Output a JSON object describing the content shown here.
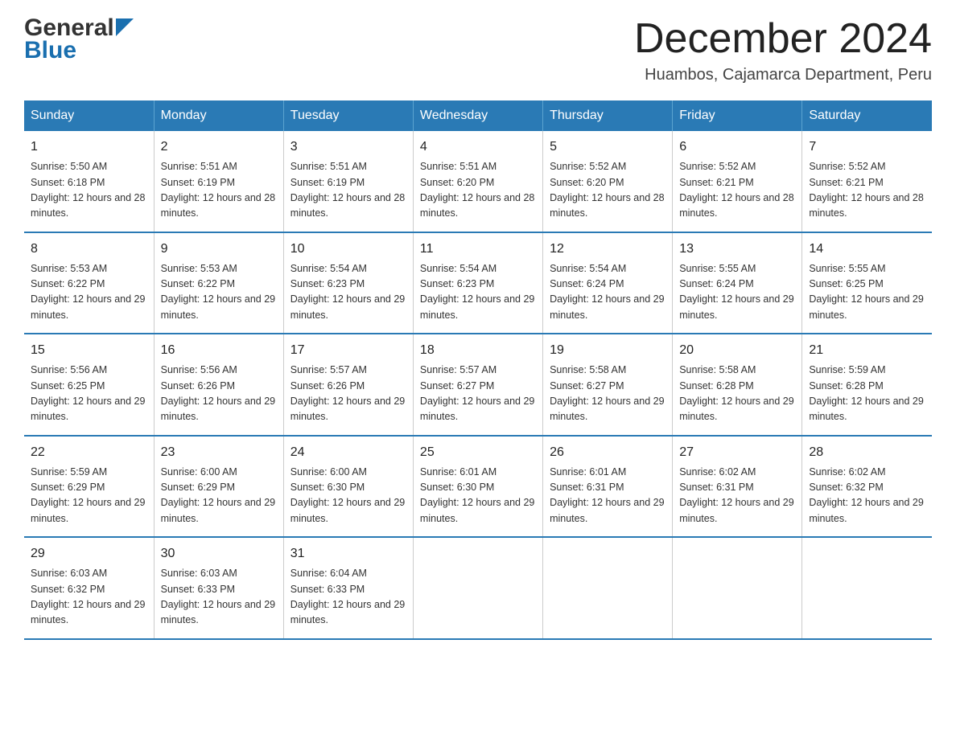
{
  "logo": {
    "general": "General",
    "blue": "Blue",
    "triangle_color": "#1a6faf"
  },
  "title": "December 2024",
  "subtitle": "Huambos, Cajamarca Department, Peru",
  "weekdays": [
    "Sunday",
    "Monday",
    "Tuesday",
    "Wednesday",
    "Thursday",
    "Friday",
    "Saturday"
  ],
  "weeks": [
    [
      {
        "day": "1",
        "sunrise": "Sunrise: 5:50 AM",
        "sunset": "Sunset: 6:18 PM",
        "daylight": "Daylight: 12 hours and 28 minutes."
      },
      {
        "day": "2",
        "sunrise": "Sunrise: 5:51 AM",
        "sunset": "Sunset: 6:19 PM",
        "daylight": "Daylight: 12 hours and 28 minutes."
      },
      {
        "day": "3",
        "sunrise": "Sunrise: 5:51 AM",
        "sunset": "Sunset: 6:19 PM",
        "daylight": "Daylight: 12 hours and 28 minutes."
      },
      {
        "day": "4",
        "sunrise": "Sunrise: 5:51 AM",
        "sunset": "Sunset: 6:20 PM",
        "daylight": "Daylight: 12 hours and 28 minutes."
      },
      {
        "day": "5",
        "sunrise": "Sunrise: 5:52 AM",
        "sunset": "Sunset: 6:20 PM",
        "daylight": "Daylight: 12 hours and 28 minutes."
      },
      {
        "day": "6",
        "sunrise": "Sunrise: 5:52 AM",
        "sunset": "Sunset: 6:21 PM",
        "daylight": "Daylight: 12 hours and 28 minutes."
      },
      {
        "day": "7",
        "sunrise": "Sunrise: 5:52 AM",
        "sunset": "Sunset: 6:21 PM",
        "daylight": "Daylight: 12 hours and 28 minutes."
      }
    ],
    [
      {
        "day": "8",
        "sunrise": "Sunrise: 5:53 AM",
        "sunset": "Sunset: 6:22 PM",
        "daylight": "Daylight: 12 hours and 29 minutes."
      },
      {
        "day": "9",
        "sunrise": "Sunrise: 5:53 AM",
        "sunset": "Sunset: 6:22 PM",
        "daylight": "Daylight: 12 hours and 29 minutes."
      },
      {
        "day": "10",
        "sunrise": "Sunrise: 5:54 AM",
        "sunset": "Sunset: 6:23 PM",
        "daylight": "Daylight: 12 hours and 29 minutes."
      },
      {
        "day": "11",
        "sunrise": "Sunrise: 5:54 AM",
        "sunset": "Sunset: 6:23 PM",
        "daylight": "Daylight: 12 hours and 29 minutes."
      },
      {
        "day": "12",
        "sunrise": "Sunrise: 5:54 AM",
        "sunset": "Sunset: 6:24 PM",
        "daylight": "Daylight: 12 hours and 29 minutes."
      },
      {
        "day": "13",
        "sunrise": "Sunrise: 5:55 AM",
        "sunset": "Sunset: 6:24 PM",
        "daylight": "Daylight: 12 hours and 29 minutes."
      },
      {
        "day": "14",
        "sunrise": "Sunrise: 5:55 AM",
        "sunset": "Sunset: 6:25 PM",
        "daylight": "Daylight: 12 hours and 29 minutes."
      }
    ],
    [
      {
        "day": "15",
        "sunrise": "Sunrise: 5:56 AM",
        "sunset": "Sunset: 6:25 PM",
        "daylight": "Daylight: 12 hours and 29 minutes."
      },
      {
        "day": "16",
        "sunrise": "Sunrise: 5:56 AM",
        "sunset": "Sunset: 6:26 PM",
        "daylight": "Daylight: 12 hours and 29 minutes."
      },
      {
        "day": "17",
        "sunrise": "Sunrise: 5:57 AM",
        "sunset": "Sunset: 6:26 PM",
        "daylight": "Daylight: 12 hours and 29 minutes."
      },
      {
        "day": "18",
        "sunrise": "Sunrise: 5:57 AM",
        "sunset": "Sunset: 6:27 PM",
        "daylight": "Daylight: 12 hours and 29 minutes."
      },
      {
        "day": "19",
        "sunrise": "Sunrise: 5:58 AM",
        "sunset": "Sunset: 6:27 PM",
        "daylight": "Daylight: 12 hours and 29 minutes."
      },
      {
        "day": "20",
        "sunrise": "Sunrise: 5:58 AM",
        "sunset": "Sunset: 6:28 PM",
        "daylight": "Daylight: 12 hours and 29 minutes."
      },
      {
        "day": "21",
        "sunrise": "Sunrise: 5:59 AM",
        "sunset": "Sunset: 6:28 PM",
        "daylight": "Daylight: 12 hours and 29 minutes."
      }
    ],
    [
      {
        "day": "22",
        "sunrise": "Sunrise: 5:59 AM",
        "sunset": "Sunset: 6:29 PM",
        "daylight": "Daylight: 12 hours and 29 minutes."
      },
      {
        "day": "23",
        "sunrise": "Sunrise: 6:00 AM",
        "sunset": "Sunset: 6:29 PM",
        "daylight": "Daylight: 12 hours and 29 minutes."
      },
      {
        "day": "24",
        "sunrise": "Sunrise: 6:00 AM",
        "sunset": "Sunset: 6:30 PM",
        "daylight": "Daylight: 12 hours and 29 minutes."
      },
      {
        "day": "25",
        "sunrise": "Sunrise: 6:01 AM",
        "sunset": "Sunset: 6:30 PM",
        "daylight": "Daylight: 12 hours and 29 minutes."
      },
      {
        "day": "26",
        "sunrise": "Sunrise: 6:01 AM",
        "sunset": "Sunset: 6:31 PM",
        "daylight": "Daylight: 12 hours and 29 minutes."
      },
      {
        "day": "27",
        "sunrise": "Sunrise: 6:02 AM",
        "sunset": "Sunset: 6:31 PM",
        "daylight": "Daylight: 12 hours and 29 minutes."
      },
      {
        "day": "28",
        "sunrise": "Sunrise: 6:02 AM",
        "sunset": "Sunset: 6:32 PM",
        "daylight": "Daylight: 12 hours and 29 minutes."
      }
    ],
    [
      {
        "day": "29",
        "sunrise": "Sunrise: 6:03 AM",
        "sunset": "Sunset: 6:32 PM",
        "daylight": "Daylight: 12 hours and 29 minutes."
      },
      {
        "day": "30",
        "sunrise": "Sunrise: 6:03 AM",
        "sunset": "Sunset: 6:33 PM",
        "daylight": "Daylight: 12 hours and 29 minutes."
      },
      {
        "day": "31",
        "sunrise": "Sunrise: 6:04 AM",
        "sunset": "Sunset: 6:33 PM",
        "daylight": "Daylight: 12 hours and 29 minutes."
      },
      null,
      null,
      null,
      null
    ]
  ]
}
